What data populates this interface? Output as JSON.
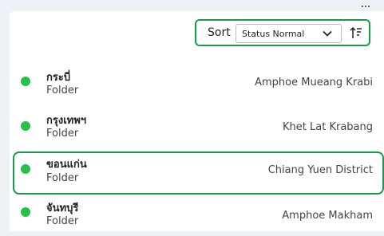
{
  "toolbar": {
    "more_icon": "more-dots-icon",
    "sort_label": "Sort",
    "sort_value": "Status Normal",
    "chevron_icon": "chevron-down-icon",
    "sort_order_icon": "sort-descending-icon",
    "accent_color": "#1a9a4b"
  },
  "items": [
    {
      "name": "กระบี่",
      "type": "Folder",
      "location": "Amphoe Mueang Krabi",
      "status_color": "#26c24a"
    },
    {
      "name": "กรุงเทพฯ",
      "type": "Folder",
      "location": "Khet Lat Krabang",
      "status_color": "#26c24a"
    },
    {
      "name": "ขอนแก่น",
      "type": "Folder",
      "location": "Chiang Yuen District",
      "status_color": "#26c24a",
      "selected": true
    },
    {
      "name": "จันทบุรี",
      "type": "Folder",
      "location": "Amphoe Makham",
      "status_color": "#26c24a"
    }
  ]
}
